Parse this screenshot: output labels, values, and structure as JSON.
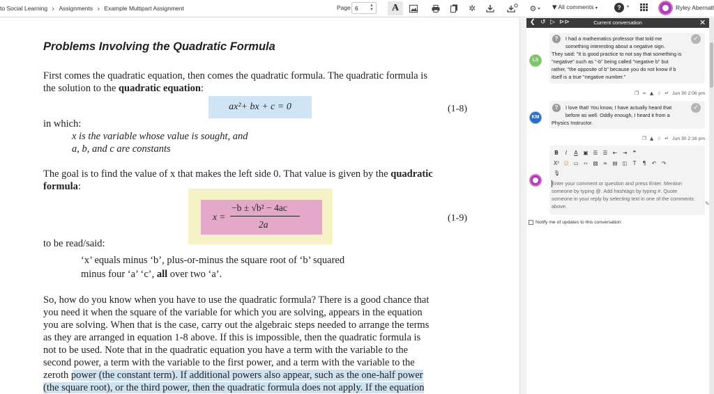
{
  "toolbar": {
    "breadcrumbs": [
      "to Social Learning",
      "Assignments",
      "Example Multipart Assignment"
    ],
    "page_label": "Page",
    "page_value": "6",
    "all_comments": "All comments",
    "user_name": "Ryley Abernath"
  },
  "doc": {
    "title": "Problems Involving the Quadratic Formula",
    "p1_l1": "First comes the quadratic equation, then comes the quadratic formula.  The quadratic formula is",
    "p1_l2_a": "the solution to the ",
    "p1_l2_b": "quadratic equation",
    "p1_l2_c": ":",
    "eq1": "ax²+ bx + c = 0",
    "eq1_num": "(1-8)",
    "in_which": "in which:",
    "def1": "x is the variable whose value is sought, and",
    "def2": "a, b, and c are constants",
    "p2_l1_a": "The goal is to find the value of x that makes the left side 0.  That value is given by the ",
    "p2_l1_b": "quadratic",
    "p2_l2_a": "formula",
    "p2_l2_b": ":",
    "eq2_lhs": "x =",
    "eq2_num_text": "−b ± √b² − 4ac",
    "eq2_den": "2a",
    "eq2_num": "(1-9)",
    "read_said": "to be read/said:",
    "read_l1": "‘x’ equals minus ‘b’, plus-or-minus the square root of ‘b’ squared",
    "read_l2_a": "minus four ‘a’ ‘c’, ",
    "read_l2_b": "all",
    "read_l2_c": " over two ‘a’.",
    "p3": [
      "So, how do you know when you have to use the quadratic formula? There is a good chance that",
      "you need it when the square of the variable for which you are solving, appears in the equation",
      "you are solving.  When that is the case, carry out the algebraic steps needed to arrange the terms",
      "as they are arranged in equation 1-8 above.  If this is impossible, then the quadratic formula is",
      "not to be used.  Note that in the quadratic equation you have a term with the variable to the",
      "second power, a term with the variable to the first power, and a term with the variable to the",
      "zeroth power (the constant term).  If additional powers also appear, such as the one-half power",
      "(the square root), or the third power, then the quadratic formula does not apply.  If the equation"
    ]
  },
  "panel": {
    "title": "Current conversation",
    "comment1": {
      "initials": "LS",
      "lines": [
        "I had a mathematics professor that told me",
        "something interesting about a negative sign.",
        "They said: \"It is good practice to not say that something is",
        "\"negative\" such as \"-b\" being called \"negative b\" but",
        "rather, \"the opposite of b\" because you do not know if b",
        "itself is a true \"negative number.\""
      ],
      "timestamp": "Jun 30 2:06 pm"
    },
    "comment2": {
      "initials": "KM",
      "lines": [
        "I love that! You know, I have actually heard that",
        "before as well. Oddly enough, I heard it from a",
        "Physics Instructor."
      ],
      "timestamp": "Jun 30 2:16 pm"
    },
    "editor": {
      "placeholder": "Enter your comment or question and press Enter. Mention someone by typing @. Add hashtags by typing #. Quote someone in your reply by selecting text in one of the comments above."
    },
    "notify": "Notify me of updates to this conversation"
  }
}
